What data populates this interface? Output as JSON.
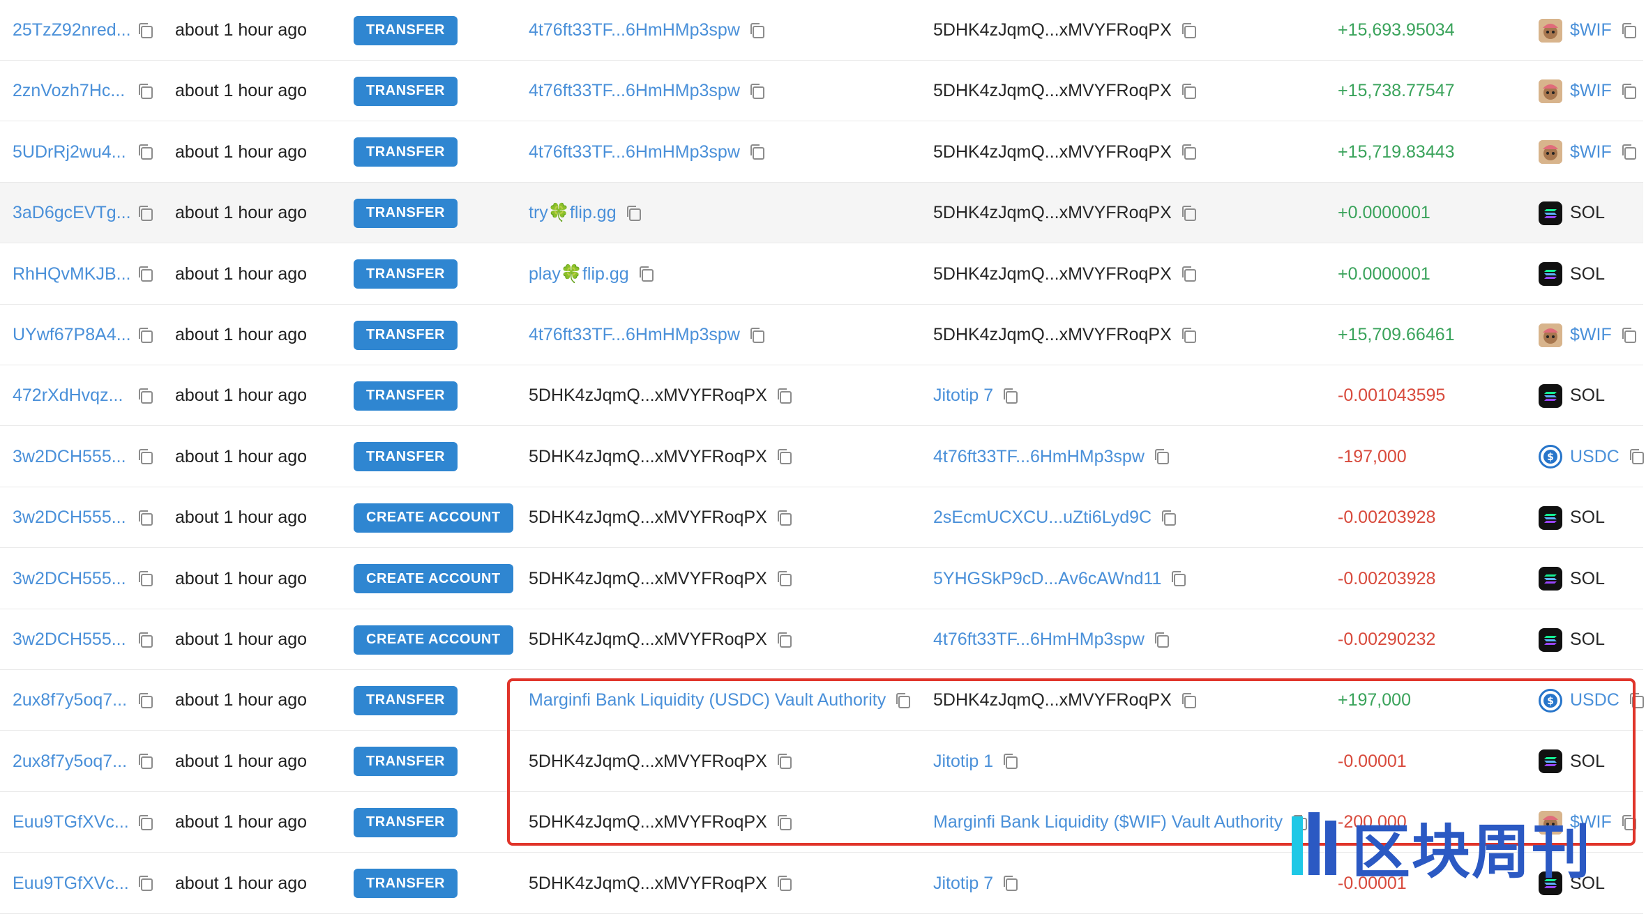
{
  "rows": [
    {
      "signature": "25TzZ92nred...",
      "time": "about 1 hour ago",
      "type": "TRANSFER",
      "from": "4t76ft33TF...6HmHMp3spw",
      "from_link": true,
      "to": "5DHK4zJqmQ...xMVYFRoqPX",
      "to_link": false,
      "amount": "+15,693.95034",
      "sign": "pos",
      "token": "$WIF",
      "token_icon": "wif-icon",
      "token_link": true
    },
    {
      "signature": "2znVozh7Hc...",
      "time": "about 1 hour ago",
      "type": "TRANSFER",
      "from": "4t76ft33TF...6HmHMp3spw",
      "from_link": true,
      "to": "5DHK4zJqmQ...xMVYFRoqPX",
      "to_link": false,
      "amount": "+15,738.77547",
      "sign": "pos",
      "token": "$WIF",
      "token_icon": "wif-icon",
      "token_link": true
    },
    {
      "signature": "5UDrRj2wu4...",
      "time": "about 1 hour ago",
      "type": "TRANSFER",
      "from": "4t76ft33TF...6HmHMp3spw",
      "from_link": true,
      "to": "5DHK4zJqmQ...xMVYFRoqPX",
      "to_link": false,
      "amount": "+15,719.83443",
      "sign": "pos",
      "token": "$WIF",
      "token_icon": "wif-icon",
      "token_link": true
    },
    {
      "signature": "3aD6gcEVTg...",
      "time": "about 1 hour ago",
      "type": "TRANSFER",
      "from": "try🍀flip.gg",
      "from_link": true,
      "to": "5DHK4zJqmQ...xMVYFRoqPX",
      "to_link": false,
      "amount": "+0.0000001",
      "sign": "pos",
      "token": "SOL",
      "token_icon": "sol-icon",
      "token_link": false
    },
    {
      "signature": "RhHQvMKJB...",
      "time": "about 1 hour ago",
      "type": "TRANSFER",
      "from": "play🍀flip.gg",
      "from_link": true,
      "to": "5DHK4zJqmQ...xMVYFRoqPX",
      "to_link": false,
      "amount": "+0.0000001",
      "sign": "pos",
      "token": "SOL",
      "token_icon": "sol-icon",
      "token_link": false
    },
    {
      "signature": "UYwf67P8A4...",
      "time": "about 1 hour ago",
      "type": "TRANSFER",
      "from": "4t76ft33TF...6HmHMp3spw",
      "from_link": true,
      "to": "5DHK4zJqmQ...xMVYFRoqPX",
      "to_link": false,
      "amount": "+15,709.66461",
      "sign": "pos",
      "token": "$WIF",
      "token_icon": "wif-icon",
      "token_link": true
    },
    {
      "signature": "472rXdHvqz...",
      "time": "about 1 hour ago",
      "type": "TRANSFER",
      "from": "5DHK4zJqmQ...xMVYFRoqPX",
      "from_link": false,
      "to": "Jitotip 7",
      "to_link": true,
      "amount": "-0.001043595",
      "sign": "neg",
      "token": "SOL",
      "token_icon": "sol-icon",
      "token_link": false
    },
    {
      "signature": "3w2DCH555...",
      "time": "about 1 hour ago",
      "type": "TRANSFER",
      "from": "5DHK4zJqmQ...xMVYFRoqPX",
      "from_link": false,
      "to": "4t76ft33TF...6HmHMp3spw",
      "to_link": true,
      "amount": "-197,000",
      "sign": "neg",
      "token": "USDC",
      "token_icon": "usdc-icon",
      "token_link": true
    },
    {
      "signature": "3w2DCH555...",
      "time": "about 1 hour ago",
      "type": "CREATE ACCOUNT",
      "from": "5DHK4zJqmQ...xMVYFRoqPX",
      "from_link": false,
      "to": "2sEcmUCXCU...uZti6Lyd9C",
      "to_link": true,
      "amount": "-0.00203928",
      "sign": "neg",
      "token": "SOL",
      "token_icon": "sol-icon",
      "token_link": false
    },
    {
      "signature": "3w2DCH555...",
      "time": "about 1 hour ago",
      "type": "CREATE ACCOUNT",
      "from": "5DHK4zJqmQ...xMVYFRoqPX",
      "from_link": false,
      "to": "5YHGSkP9cD...Av6cAWnd11",
      "to_link": true,
      "amount": "-0.00203928",
      "sign": "neg",
      "token": "SOL",
      "token_icon": "sol-icon",
      "token_link": false
    },
    {
      "signature": "3w2DCH555...",
      "time": "about 1 hour ago",
      "type": "CREATE ACCOUNT",
      "from": "5DHK4zJqmQ...xMVYFRoqPX",
      "from_link": false,
      "to": "4t76ft33TF...6HmHMp3spw",
      "to_link": true,
      "amount": "-0.00290232",
      "sign": "neg",
      "token": "SOL",
      "token_icon": "sol-icon",
      "token_link": false
    },
    {
      "signature": "2ux8f7y5oq7...",
      "time": "about 1 hour ago",
      "type": "TRANSFER",
      "from": "Marginfi Bank Liquidity (USDC) Vault Authority",
      "from_link": true,
      "to": "5DHK4zJqmQ...xMVYFRoqPX",
      "to_link": false,
      "amount": "+197,000",
      "sign": "pos",
      "token": "USDC",
      "token_icon": "usdc-icon",
      "token_link": true
    },
    {
      "signature": "2ux8f7y5oq7...",
      "time": "about 1 hour ago",
      "type": "TRANSFER",
      "from": "5DHK4zJqmQ...xMVYFRoqPX",
      "from_link": false,
      "to": "Jitotip 1",
      "to_link": true,
      "amount": "-0.00001",
      "sign": "neg",
      "token": "SOL",
      "token_icon": "sol-icon",
      "token_link": false
    },
    {
      "signature": "Euu9TGfXVc...",
      "time": "about 1 hour ago",
      "type": "TRANSFER",
      "from": "5DHK4zJqmQ...xMVYFRoqPX",
      "from_link": false,
      "to": "Marginfi Bank Liquidity ($WIF) Vault Authority",
      "to_link": true,
      "amount": "-200,000",
      "sign": "neg",
      "token": "$WIF",
      "token_icon": "wif-icon",
      "token_link": true
    },
    {
      "signature": "Euu9TGfXVc...",
      "time": "about 1 hour ago",
      "type": "TRANSFER",
      "from": "5DHK4zJqmQ...xMVYFRoqPX",
      "from_link": false,
      "to": "Jitotip 7",
      "to_link": true,
      "amount": "-0.00001",
      "sign": "neg",
      "token": "SOL",
      "token_icon": "sol-icon",
      "token_link": false
    }
  ],
  "watermark": {
    "text": "区块周刊",
    "icon": "block-weekly-logo-icon"
  },
  "colors": {
    "link": "#4a90d9",
    "positive": "#3aa35b",
    "negative": "#d84a3c",
    "badge": "#2f86d1",
    "highlight": "#e0342a"
  }
}
